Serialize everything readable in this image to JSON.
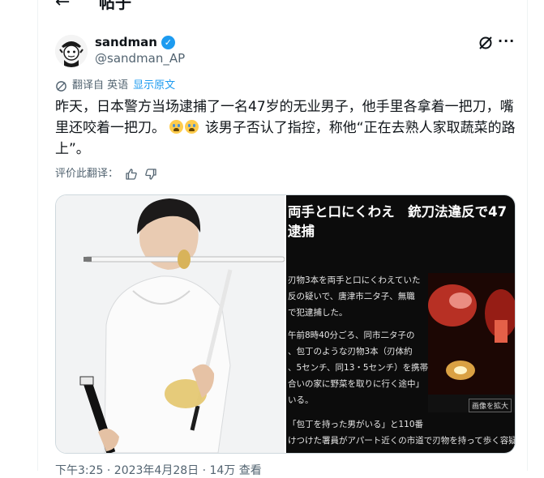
{
  "header": {
    "back_label": "←",
    "title": "帖子"
  },
  "author": {
    "display_name": "sandman",
    "handle": "@sandman_AP",
    "verified_mark": "✓"
  },
  "icons": {
    "back": "arrow-left-icon",
    "verified": "verified-badge-icon",
    "grok": "grok-icon",
    "more": "more-icon",
    "translate": "translate-icon",
    "like": "thumbs-up-icon",
    "dislike": "thumbs-down-icon"
  },
  "actions": {
    "more_label": "···"
  },
  "translation": {
    "label": "翻译自 英语",
    "show_original": "显示原文"
  },
  "tweet": {
    "text_part1": "昨天，日本警方当场逮捕了一名47岁的无业男子，他手里各拿着一把刀，嘴里还咬着一把刀。",
    "text_part2": " 该男子否认了指控，称他“正在去熟人家取蔬菜的路上”。"
  },
  "rating": {
    "label": "评价此翻译："
  },
  "media": {
    "right_image": {
      "headline_line1": "両手と口にくわえ　銃刀法違反で47",
      "headline_line2": "逮捕",
      "body_lines": [
        "刃物3本を両手と口にくわえていた",
        "反の疑いで、唐津市二タ子、無職",
        "で犯逮捕した。",
        "午前8時40分ごろ、同市二タ子の",
        "、包丁のような刃物3本（刃体約",
        "、5センチ、同13・5センチ）を携帯",
        "合いの家に野菜を取りに行く途中」",
        "いる。",
        "「包丁を持った男がいる」と110番",
        "けつけた署員がアパート近くの市道で刃物を持って歩く容疑"
      ],
      "enlarge_label": "画像を拡大"
    }
  },
  "footer": {
    "timestamp_partial": "下午3:25 · 2023年4月28日 · 14万 查看"
  },
  "colors": {
    "accent": "#1d9bf0",
    "text": "#0f1419",
    "secondary": "#536471",
    "border": "#eff3f4"
  }
}
